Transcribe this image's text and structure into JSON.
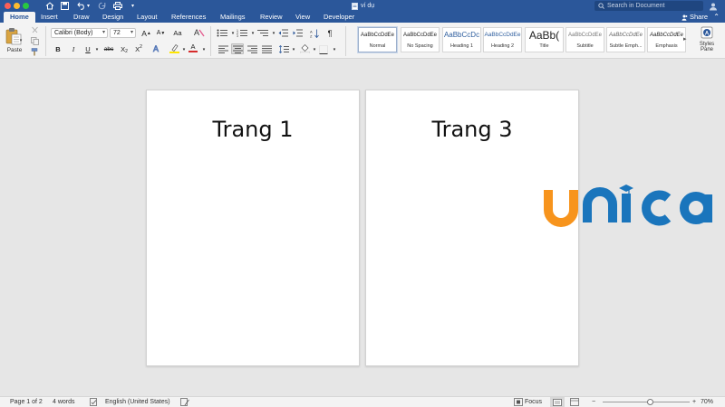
{
  "window": {
    "title": "ví dụ",
    "search_placeholder": "Search in Document"
  },
  "tabs": [
    {
      "label": "Home",
      "active": true
    },
    {
      "label": "Insert"
    },
    {
      "label": "Draw"
    },
    {
      "label": "Design"
    },
    {
      "label": "Layout"
    },
    {
      "label": "References"
    },
    {
      "label": "Mailings"
    },
    {
      "label": "Review"
    },
    {
      "label": "View"
    },
    {
      "label": "Developer"
    }
  ],
  "share_label": "Share",
  "ribbon": {
    "paste_label": "Paste",
    "font_name": "Calibri (Body)",
    "font_size": "72",
    "bold": "B",
    "italic": "I",
    "underline": "U",
    "strikethrough": "abc",
    "subscript": "X",
    "superscript": "X",
    "font_color_letter": "A",
    "highlight_color": "#ffe600",
    "font_color": "#d62b2b",
    "styles_pane_label": "Styles Pane",
    "styles": [
      {
        "sample": "AaBbCcDdEe",
        "name": "Normal",
        "selected": true
      },
      {
        "sample": "AaBbCcDdEe",
        "name": "No Spacing"
      },
      {
        "sample": "AaBbCcDc",
        "name": "Heading 1"
      },
      {
        "sample": "AaBbCcDdEe",
        "name": "Heading 2"
      },
      {
        "sample": "AaBb(",
        "name": "Title"
      },
      {
        "sample": "AaBbCcDdEe",
        "name": "Subtitle"
      },
      {
        "sample": "AaBbCcDdEe",
        "name": "Subtle Emph..."
      },
      {
        "sample": "AaBbCcDdEe",
        "name": "Emphasis"
      }
    ]
  },
  "pages": [
    {
      "text": "Trang 1"
    },
    {
      "text": "Trang 3"
    }
  ],
  "logo": {
    "text": "unica",
    "orange": "#f7941d",
    "blue": "#1a75bc"
  },
  "status": {
    "page": "Page 1 of 2",
    "words": "4 words",
    "language": "English (United States)",
    "focus": "Focus",
    "zoom": "70%"
  },
  "colors": {
    "word_blue": "#2b579a"
  }
}
